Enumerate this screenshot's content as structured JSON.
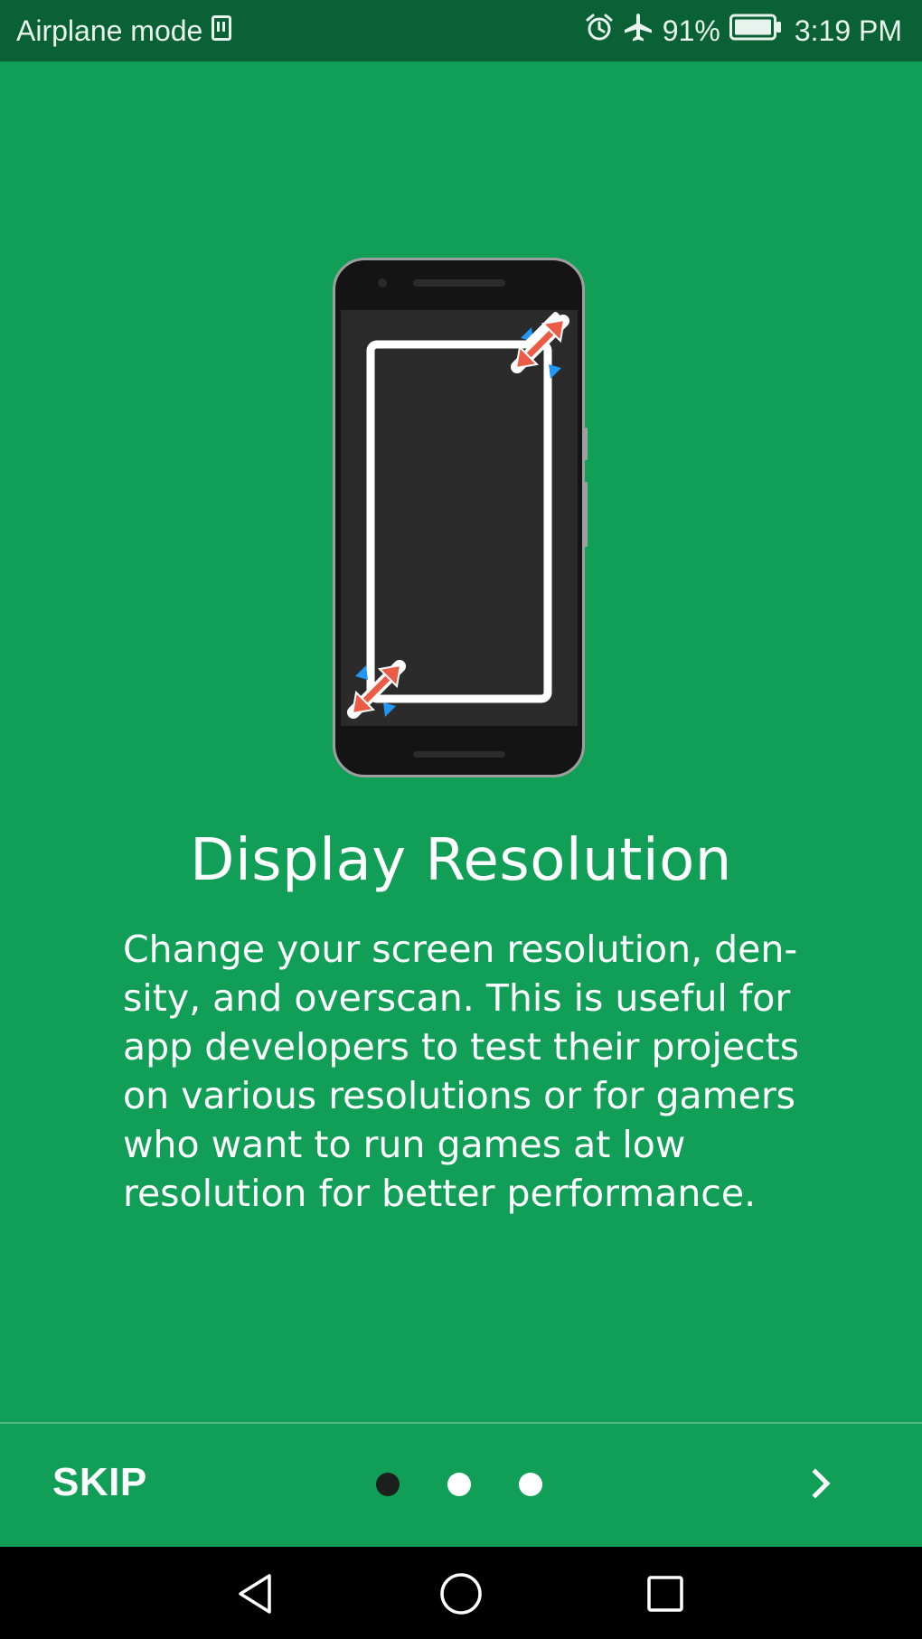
{
  "status_bar": {
    "left_text": "Airplane mode",
    "battery": "91%",
    "time": "3:19 PM",
    "icons": [
      "sim-icon",
      "alarm-icon",
      "airplane-icon",
      "battery-icon"
    ]
  },
  "slide": {
    "title": "Display Resolution",
    "description": "Change your screen resolution, den-sity, and overscan. This is useful for app developers to test their projects on various resolutions or for gamers who want to run games at low resolution for better performance.",
    "illustration": "phone-resize-illustration"
  },
  "bottom": {
    "skip_label": "SKIP",
    "page_count": 3,
    "current_page": 1
  },
  "nav_bar": {
    "icons": [
      "back-icon",
      "home-icon",
      "recents-icon"
    ]
  },
  "colors": {
    "background": "#119F58",
    "status_bar": "#0A6136",
    "resize_arrow": "#EB5B45",
    "resize_arrow_secondary": "#2196F3"
  }
}
